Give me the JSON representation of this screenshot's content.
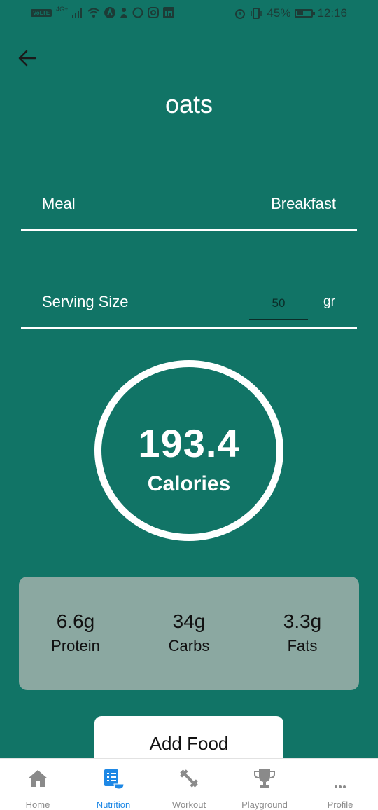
{
  "status_bar": {
    "volte": "VoLTE",
    "network": "4G+",
    "battery": "45%",
    "time": "12:16"
  },
  "header": {
    "title": "oats"
  },
  "meal_row": {
    "label": "Meal",
    "value": "Breakfast"
  },
  "serving_row": {
    "label": "Serving Size",
    "value": "50",
    "unit": "gr"
  },
  "calories": {
    "value": "193.4",
    "label": "Calories"
  },
  "macros": [
    {
      "amount": "6.6g",
      "name": "Protein"
    },
    {
      "amount": "34g",
      "name": "Carbs"
    },
    {
      "amount": "3.3g",
      "name": "Fats"
    }
  ],
  "add_food": {
    "label": "Add Food"
  },
  "bottom_nav": {
    "items": [
      {
        "label": "Home",
        "icon": "home-icon"
      },
      {
        "label": "Nutrition",
        "icon": "nutrition-icon"
      },
      {
        "label": "Workout",
        "icon": "dumbbell-icon"
      },
      {
        "label": "Playground",
        "icon": "trophy-icon"
      },
      {
        "label": "Profile",
        "icon": "more-icon"
      }
    ]
  },
  "colors": {
    "background": "#117466",
    "macro_card": "#8ba8a1",
    "nav_active": "#1e88e5",
    "nav_inactive": "#8a8a8a"
  }
}
